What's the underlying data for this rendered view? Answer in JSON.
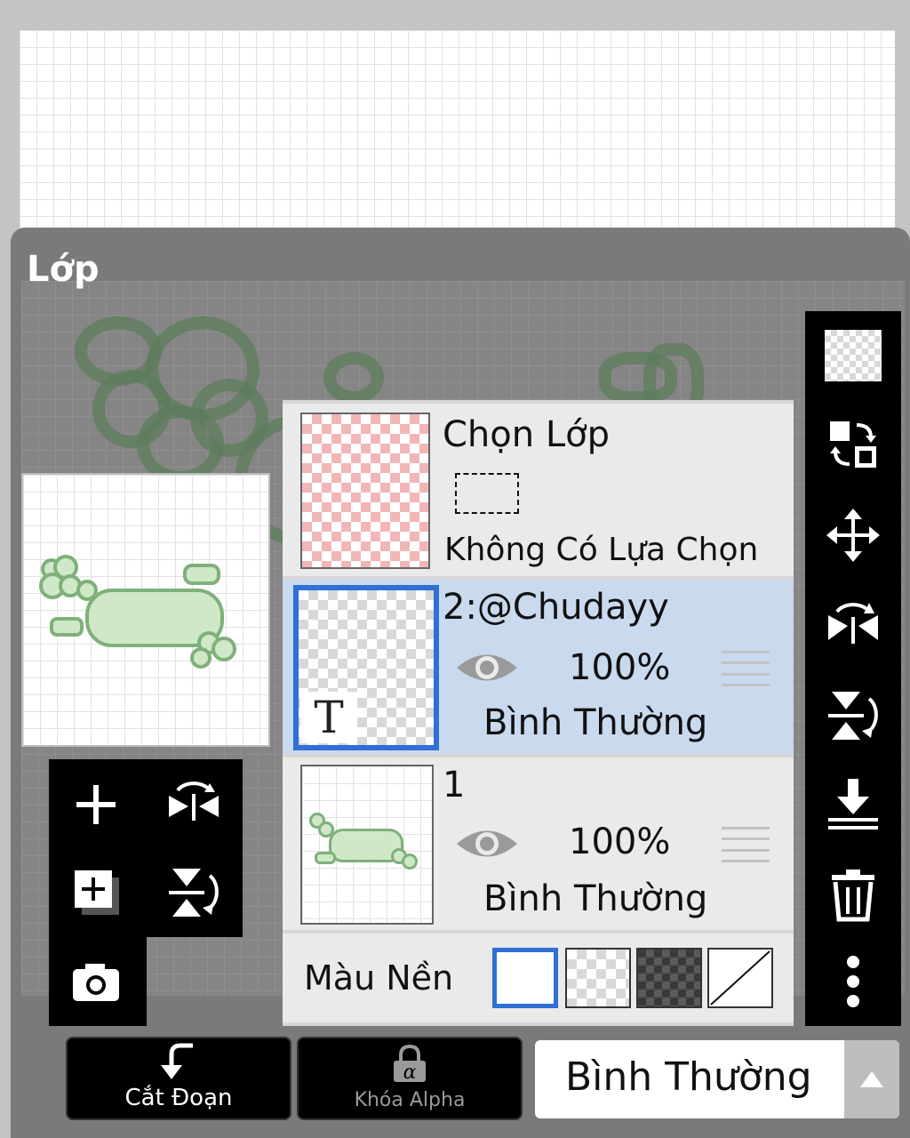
{
  "panel": {
    "title": "Lớp"
  },
  "preview": {
    "caption": ""
  },
  "selection_row": {
    "title": "Chọn Lớp",
    "subtitle": "Không Có Lựa Chọn"
  },
  "layers": [
    {
      "name": "2:@Chudayy",
      "opacity": "100%",
      "blend": "Bình Thường",
      "selected": true,
      "type_icon": "text-layer-icon"
    },
    {
      "name": "1",
      "opacity": "100%",
      "blend": "Bình Thường",
      "selected": false,
      "type_icon": "none"
    }
  ],
  "background_row": {
    "label": "Màu Nền",
    "options": [
      "white",
      "transparent",
      "dark",
      "none"
    ],
    "selected": "white"
  },
  "bottom_bar": {
    "clip_label": "Cắt Đoạn",
    "alpha_lock_label": "Khóa Alpha",
    "blend_mode_value": "Bình Thường"
  },
  "right_toolbar": [
    "checker-icon",
    "swap-icon",
    "move-icon",
    "flip-horizontal-icon",
    "flip-vertical-icon",
    "merge-down-icon",
    "trash-icon",
    "more-icon"
  ],
  "left_toolbar": [
    "add-layer-icon",
    "flip-horizontal-icon",
    "duplicate-layer-icon",
    "flip-vertical-icon",
    "camera-icon"
  ],
  "colors": {
    "accent": "#2f6fd6",
    "selected_row": "#c9d9ee",
    "panel_bg": "#7a7a7a"
  }
}
